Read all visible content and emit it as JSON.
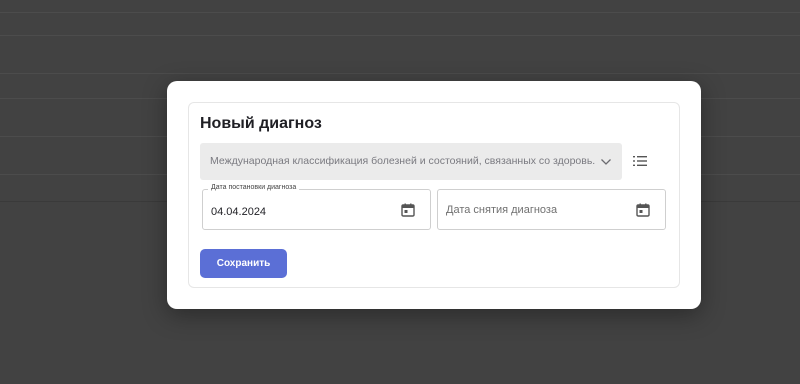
{
  "colors": {
    "overlay": "#424242",
    "primary_button": "#5b6fd6",
    "select_background": "#ebebeb"
  },
  "modal": {
    "title": "Новый диагноз",
    "icd_select": {
      "value": "Международная классификация болезней и состояний, связанных со здоровь...",
      "chevron_icon": "chevron-down-icon",
      "list_icon": "list-icon"
    },
    "diagnosis_date": {
      "label": "Дата постановки диагноза",
      "value": "04.04.2024",
      "icon": "calendar-icon"
    },
    "removal_date": {
      "placeholder": "Дата снятия диагноза",
      "icon": "calendar-icon"
    },
    "save_label": "Сохранить"
  }
}
